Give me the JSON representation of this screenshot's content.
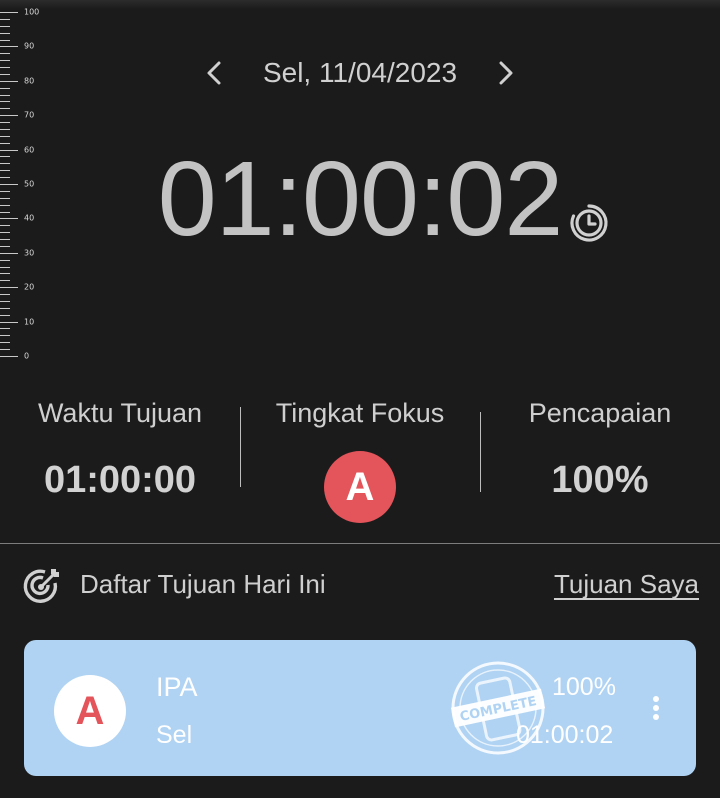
{
  "ruler": {
    "labels": [
      "100",
      "90",
      "80",
      "70",
      "60",
      "50",
      "40",
      "30",
      "20",
      "10",
      "0"
    ]
  },
  "date_nav": {
    "date": "Sel, 11/04/2023",
    "prev_icon": "chevron-left-icon",
    "next_icon": "chevron-right-icon"
  },
  "timer": {
    "value": "01:00:02",
    "icon": "history-clock-icon"
  },
  "stats": {
    "target_time": {
      "title": "Waktu Tujuan",
      "value": "01:00:00"
    },
    "focus_level": {
      "title": "Tingkat Fokus",
      "grade": "A",
      "color": "#e4545b"
    },
    "achievement": {
      "title": "Pencapaian",
      "value": "100%"
    }
  },
  "goals": {
    "icon": "target-arrow-icon",
    "title": "Daftar Tujuan Hari Ini",
    "link": "Tujuan Saya",
    "items": [
      {
        "grade": "A",
        "name": "IPA",
        "day": "Sel",
        "stamp": "COMPLETE",
        "percent": "100%",
        "time": "01:00:02",
        "card_color": "#b0d3f3"
      }
    ]
  }
}
